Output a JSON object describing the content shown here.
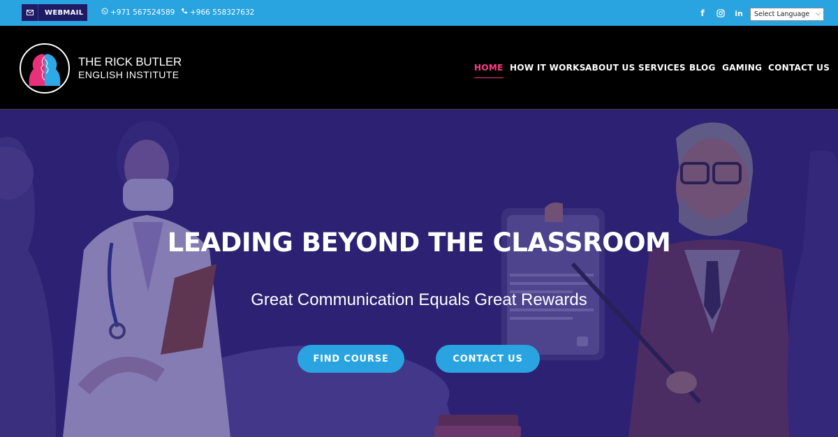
{
  "topbar": {
    "webmail_label": "WEBMAIL",
    "phone_whatsapp": "+971 567524589",
    "phone_call": "+966 558327632",
    "social": [
      "facebook-icon",
      "instagram-icon",
      "linkedin-icon"
    ],
    "language_select": "Select Language"
  },
  "header": {
    "logo_line1": "THE RICK BUTLER",
    "logo_line2": "ENGLISH INSTITUTE",
    "nav": [
      "HOME",
      "HOW IT WORKS",
      "ABOUT US",
      "SERVICES",
      "BLOG",
      "GAMING",
      "CONTACT US"
    ],
    "active_nav": "HOME"
  },
  "hero": {
    "headline": "LEADING BEYOND THE CLASSROOM",
    "subheadline": "Great Communication Equals Great Rewards",
    "buttons": [
      "FIND COURSE",
      "CONTACT US"
    ]
  },
  "colors": {
    "topbar": "#29a4e0",
    "webmail_bg": "#1e1a66",
    "header": "#000000",
    "nav_active": "#ff3b86",
    "hero_bg": "#2e2272",
    "button": "#29a4e0"
  }
}
